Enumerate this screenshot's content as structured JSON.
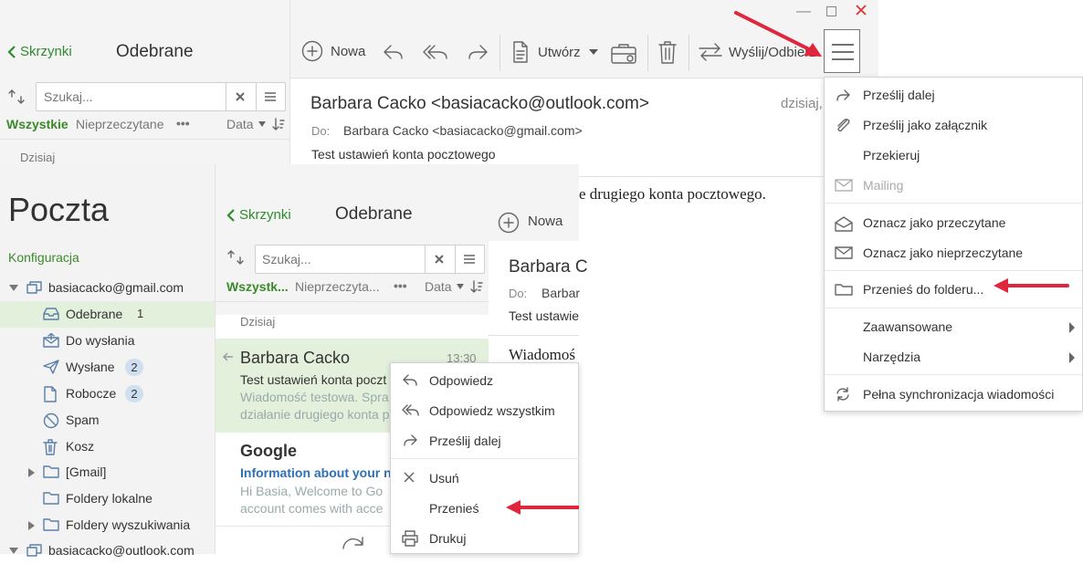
{
  "bg_window": {
    "nav_back": "Skrzynki",
    "title": "Odebrane",
    "toolbar": {
      "new_label": "Nowa",
      "create_label": "Utwórz",
      "send_receive_label": "Wyślij/Odbierz"
    },
    "search": {
      "placeholder": "Szukaj..."
    },
    "filters": {
      "all": "Wszystkie",
      "unread": "Nieprzeczytane",
      "more": "•••",
      "sort": "Data"
    },
    "group_today": "Dzisiaj",
    "message": {
      "from": "Barbara Cacko <basiacacko@outlook.com>",
      "date": "dzisiaj,",
      "to_label": "Do:",
      "to": "Barbara Cacko <basiacacko@gmail.com>",
      "subject": "Test ustawień konta pocztowego",
      "body": "e drugiego konta pocztowego."
    }
  },
  "hamburger_menu": {
    "items": [
      {
        "label": "Prześlij dalej",
        "icon": "forward-icon",
        "disabled": false
      },
      {
        "label": "Prześlij jako załącznik",
        "icon": "paperclip-icon",
        "disabled": false
      },
      {
        "label": "Przekieruj",
        "icon": "",
        "disabled": false
      },
      {
        "label": "Mailing",
        "icon": "mailing-icon",
        "disabled": true
      },
      {
        "label": "Oznacz jako przeczytane",
        "icon": "envelope-open-icon",
        "disabled": false
      },
      {
        "label": "Oznacz jako nieprzeczytane",
        "icon": "envelope-icon",
        "disabled": false
      },
      {
        "label": "Przenieś do folderu...",
        "icon": "folder-icon",
        "disabled": false
      },
      {
        "label": "Zaawansowane",
        "icon": "",
        "disabled": false
      },
      {
        "label": "Narzędzia",
        "icon": "",
        "disabled": false
      },
      {
        "label": "Pełna synchronizacja wiadomości",
        "icon": "sync-icon",
        "disabled": false
      }
    ]
  },
  "front_window": {
    "app_title": "Poczta",
    "config_link": "Konfiguracja",
    "accounts": [
      {
        "name": "basiacacko@gmail.com"
      },
      {
        "name": "basiacacko@outlook.com"
      }
    ],
    "folders": [
      {
        "name": "Odebrane",
        "count": "1",
        "icon": "inbox-icon"
      },
      {
        "name": "Do wysłania",
        "count": "",
        "icon": "outbox-icon"
      },
      {
        "name": "Wysłane",
        "count": "2",
        "icon": "sent-icon"
      },
      {
        "name": "Robocze",
        "count": "2",
        "icon": "drafts-icon"
      },
      {
        "name": "Spam",
        "count": "",
        "icon": "spam-icon"
      },
      {
        "name": "Kosz",
        "count": "",
        "icon": "trash-icon"
      },
      {
        "name": "[Gmail]",
        "count": "",
        "icon": "folder-icon"
      },
      {
        "name": "Foldery lokalne",
        "count": "",
        "icon": "folder-icon"
      },
      {
        "name": "Foldery wyszukiwania",
        "count": "",
        "icon": "folder-icon"
      }
    ],
    "nav_back": "Skrzynki",
    "title": "Odebrane",
    "new_label": "Nowa",
    "search": {
      "placeholder": "Szukaj..."
    },
    "filters": {
      "all": "Wszystk...",
      "unread": "Nieprzeczyta...",
      "more": "•••",
      "sort": "Data"
    },
    "group_today": "Dzisiaj",
    "messages": [
      {
        "from": "Barbara Cacko",
        "time": "13:30",
        "subject": "Test ustawień konta poczt",
        "preview1": "Wiadomość testowa. Spra",
        "preview2": "działanie drugiego konta p"
      },
      {
        "from": "Google",
        "time": "",
        "subject": "Information about your ne",
        "preview1": "Hi Basia, Welcome to Go",
        "preview2": "account comes with acce"
      }
    ],
    "preview": {
      "from": "Barbara C",
      "to_label": "Do:",
      "to": "Barbar",
      "subject": "Test ustawie",
      "body": "Wiadomoś"
    }
  },
  "context_menu": {
    "items": [
      {
        "label": "Odpowiedz",
        "icon": "reply-icon"
      },
      {
        "label": "Odpowiedz wszystkim",
        "icon": "reply-all-icon"
      },
      {
        "label": "Prześlij dalej",
        "icon": "forward-icon"
      },
      {
        "label": "Usuń",
        "icon": "delete-icon"
      },
      {
        "label": "Przenieś",
        "icon": ""
      },
      {
        "label": "Drukuj",
        "icon": "print-icon"
      }
    ]
  },
  "colors": {
    "accent_green": "#2e8b2e",
    "selection_green": "#e3f0dc",
    "annotation_red": "#e0263c",
    "link_blue": "#2f6fb3"
  }
}
